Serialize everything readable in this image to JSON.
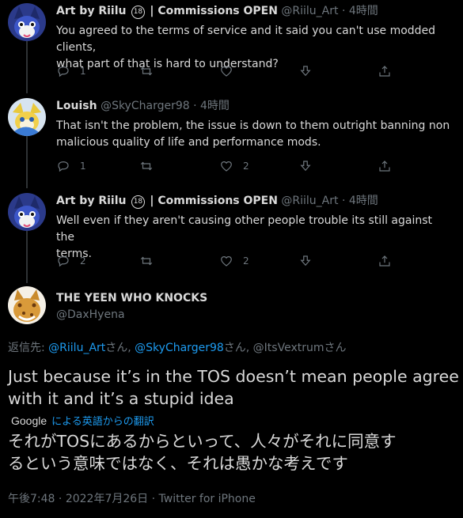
{
  "tweets": [
    {
      "name": "Art by Riilu",
      "badge": "18",
      "name_suffix": "| Commissions OPEN",
      "handle": "@Riilu_Art",
      "sep": "·",
      "time": "4時間",
      "text_line1": "You agreed to the terms of service and it said you can't use modded clients,",
      "text_line2": "what part of that is hard to understand?",
      "reply_count": "1",
      "retweet_count": "",
      "like_count": ""
    },
    {
      "name": "Louish",
      "handle": "@SkyCharger98",
      "sep": "·",
      "time": "4時間",
      "text_line1": "That isn't the problem, the issue is down to them outright banning non",
      "text_line2": "malicious quality of life and performance mods.",
      "reply_count": "1",
      "retweet_count": "",
      "like_count": "2"
    },
    {
      "name": "Art by Riilu",
      "badge": "18",
      "name_suffix": "| Commissions OPEN",
      "handle": "@Riilu_Art",
      "sep": "·",
      "time": "4時間",
      "text_line1": "Well even if they aren't causing other people trouble its still against the",
      "text_line2": "terms.",
      "reply_count": "2",
      "retweet_count": "",
      "like_count": "2"
    }
  ],
  "main": {
    "name": "THE YEEN WHO KNOCKS",
    "handle": "@DaxHyena",
    "reply_prefix": "返信先:",
    "reply_users": [
      "@Riilu_Art",
      "@SkyCharger98",
      "@ItsVextrum"
    ],
    "honorific": "さん",
    "comma": ",",
    "text_line1": "Just because it’s in the TOS doesn’t mean people agree",
    "text_line2": "with it and it’s a stupid idea",
    "translate_brand": "Google",
    "translate_label": "による英語からの翻訳",
    "translated_line1": "それがTOSにあるからといって、人々がそれに同意す",
    "translated_line2": "るという意味ではなく、それは愚かな考えです",
    "time": "午後7:48",
    "sep": "·",
    "date": "2022年7月26日",
    "source": "Twitter for iPhone"
  },
  "colors": {
    "background": "#000000",
    "text": "#d9d9d9",
    "muted": "#6e767d",
    "link": "#1d9bf0",
    "thread": "#2f3336"
  },
  "icons": [
    "reply-icon",
    "retweet-icon",
    "like-icon",
    "download-icon",
    "share-icon"
  ]
}
